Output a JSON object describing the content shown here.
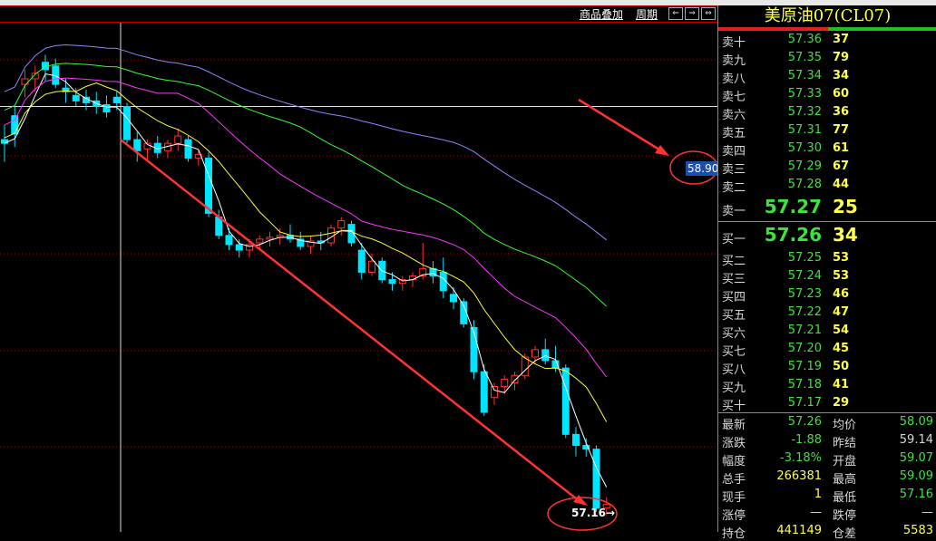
{
  "toolbar": {
    "overlay_label": "商品叠加",
    "period_label": "周期"
  },
  "chart": {
    "crosshair_price": "58.90",
    "last_price_label": "57.16→",
    "colors": {
      "up": "#ff3030",
      "down": "#00e5ff",
      "ma1": "#ffffff",
      "ma2": "#ffff33",
      "ma3": "#ff33ff",
      "ma4": "#33ff33",
      "ma5": "#8888ff",
      "annotation": "#ff3333"
    }
  },
  "chart_data": {
    "type": "candlestick",
    "crosshair_y": 58.9,
    "last": 57.16,
    "ohlc": [
      [
        58.72,
        58.8,
        58.6,
        58.7
      ],
      [
        58.85,
        58.9,
        58.68,
        58.75
      ],
      [
        59.02,
        59.1,
        58.95,
        59.05
      ],
      [
        59.05,
        59.12,
        58.98,
        59.08
      ],
      [
        59.14,
        59.18,
        59.04,
        59.1
      ],
      [
        59.12,
        59.16,
        59.0,
        59.02
      ],
      [
        59.0,
        59.05,
        58.92,
        58.98
      ],
      [
        58.96,
        59.0,
        58.9,
        58.93
      ],
      [
        58.95,
        58.99,
        58.88,
        58.92
      ],
      [
        58.93,
        58.98,
        58.86,
        58.9
      ],
      [
        58.91,
        58.96,
        58.84,
        58.87
      ],
      [
        58.95,
        58.98,
        58.88,
        58.92
      ],
      [
        58.9,
        58.92,
        58.7,
        58.72
      ],
      [
        58.72,
        58.76,
        58.6,
        58.66
      ],
      [
        58.67,
        58.72,
        58.6,
        58.7
      ],
      [
        58.7,
        58.74,
        58.62,
        58.65
      ],
      [
        58.66,
        58.72,
        58.62,
        58.7
      ],
      [
        58.7,
        58.78,
        58.66,
        58.74
      ],
      [
        58.72,
        58.74,
        58.6,
        58.62
      ],
      [
        58.62,
        58.66,
        58.58,
        58.64
      ],
      [
        58.62,
        58.65,
        58.3,
        58.32
      ],
      [
        58.3,
        58.34,
        58.18,
        58.2
      ],
      [
        58.2,
        58.24,
        58.12,
        58.15
      ],
      [
        58.15,
        58.18,
        58.08,
        58.12
      ],
      [
        58.12,
        58.18,
        58.08,
        58.15
      ],
      [
        58.16,
        58.2,
        58.12,
        58.18
      ],
      [
        58.18,
        58.22,
        58.14,
        58.19
      ],
      [
        58.19,
        58.24,
        58.15,
        58.2
      ],
      [
        58.2,
        58.26,
        58.16,
        58.18
      ],
      [
        58.18,
        58.22,
        58.12,
        58.14
      ],
      [
        58.14,
        58.2,
        58.1,
        58.17
      ],
      [
        58.17,
        58.22,
        58.12,
        58.16
      ],
      [
        58.16,
        58.26,
        58.14,
        58.24
      ],
      [
        58.24,
        58.3,
        58.2,
        58.28
      ],
      [
        58.26,
        58.28,
        58.14,
        58.16
      ],
      [
        58.12,
        58.16,
        57.96,
        58.0
      ],
      [
        58.0,
        58.1,
        57.98,
        58.06
      ],
      [
        58.06,
        58.08,
        57.94,
        57.96
      ],
      [
        57.96,
        58.0,
        57.9,
        57.94
      ],
      [
        57.94,
        57.98,
        57.9,
        57.96
      ],
      [
        57.96,
        58.0,
        57.92,
        57.98
      ],
      [
        57.98,
        58.16,
        57.96,
        58.02
      ],
      [
        58.02,
        58.06,
        57.94,
        57.98
      ],
      [
        58.0,
        58.08,
        57.86,
        57.9
      ],
      [
        57.88,
        57.92,
        57.8,
        57.84
      ],
      [
        57.84,
        57.86,
        57.7,
        57.72
      ],
      [
        57.7,
        57.74,
        57.42,
        57.46
      ],
      [
        57.46,
        57.5,
        57.22,
        57.24
      ],
      [
        57.32,
        57.4,
        57.28,
        57.38
      ],
      [
        57.38,
        57.44,
        57.34,
        57.42
      ],
      [
        57.4,
        57.46,
        57.36,
        57.44
      ],
      [
        57.44,
        57.56,
        57.42,
        57.54
      ],
      [
        57.54,
        57.6,
        57.5,
        57.58
      ],
      [
        57.58,
        57.64,
        57.5,
        57.52
      ],
      [
        57.52,
        57.6,
        57.46,
        57.48
      ],
      [
        57.48,
        57.5,
        57.1,
        57.12
      ],
      [
        57.12,
        57.16,
        57.0,
        57.06
      ],
      [
        57.06,
        57.1,
        57.0,
        57.04
      ],
      [
        57.04,
        57.06,
        56.7,
        56.72
      ],
      [
        56.72,
        56.78,
        56.68,
        56.74
      ]
    ]
  },
  "panel": {
    "title": "美原油07(CL07)",
    "asks": [
      {
        "label": "卖十",
        "price": "57.36",
        "vol": "37"
      },
      {
        "label": "卖九",
        "price": "57.35",
        "vol": "79"
      },
      {
        "label": "卖八",
        "price": "57.34",
        "vol": "34"
      },
      {
        "label": "卖七",
        "price": "57.33",
        "vol": "60"
      },
      {
        "label": "卖六",
        "price": "57.32",
        "vol": "36"
      },
      {
        "label": "卖五",
        "price": "57.31",
        "vol": "77"
      },
      {
        "label": "卖四",
        "price": "57.30",
        "vol": "61"
      },
      {
        "label": "卖三",
        "price": "57.29",
        "vol": "67"
      },
      {
        "label": "卖二",
        "price": "57.28",
        "vol": "44"
      }
    ],
    "ask1": {
      "label": "卖一",
      "price": "57.27",
      "vol": "25"
    },
    "bid1": {
      "label": "买一",
      "price": "57.26",
      "vol": "34"
    },
    "bids": [
      {
        "label": "买二",
        "price": "57.25",
        "vol": "53"
      },
      {
        "label": "买三",
        "price": "57.24",
        "vol": "53"
      },
      {
        "label": "买四",
        "price": "57.23",
        "vol": "46"
      },
      {
        "label": "买五",
        "price": "57.22",
        "vol": "47"
      },
      {
        "label": "买六",
        "price": "57.21",
        "vol": "54"
      },
      {
        "label": "买七",
        "price": "57.20",
        "vol": "45"
      },
      {
        "label": "买八",
        "price": "57.19",
        "vol": "50"
      },
      {
        "label": "买九",
        "price": "57.18",
        "vol": "41"
      },
      {
        "label": "买十",
        "price": "57.17",
        "vol": "29"
      }
    ],
    "stats": {
      "latest_label": "最新",
      "latest": "57.26",
      "avg_label": "均价",
      "avg": "58.09",
      "change_label": "涨跌",
      "change": "-1.88",
      "prev_label": "昨结",
      "prev": "59.14",
      "range_label": "幅度",
      "range": "-3.18%",
      "open_label": "开盘",
      "open": "59.07",
      "vol_label": "总手",
      "vol": "266381",
      "high_label": "最高",
      "high": "59.09",
      "cur_label": "现手",
      "cur": "1",
      "low_label": "最低",
      "low": "57.16",
      "limup_label": "涨停",
      "limup": "—",
      "limdn_label": "跌停",
      "limdn": "—",
      "hold_label": "持仓",
      "hold": "441149",
      "diff_label": "仓差",
      "diff": "5583"
    }
  }
}
